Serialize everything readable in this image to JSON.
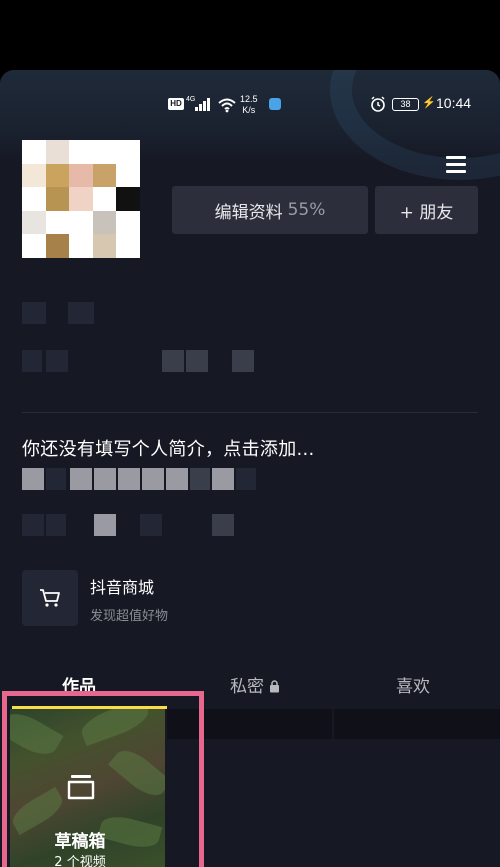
{
  "status_bar": {
    "hd_badge": "HD",
    "network": "4G",
    "speed_value": "12.5",
    "speed_unit": "K/s",
    "battery": "38",
    "time": "10:44"
  },
  "profile": {
    "edit_button_label": "编辑资料",
    "edit_progress": "55%",
    "add_friend_label": "+ 朋友",
    "bio_placeholder": "你还没有填写个人简介，点击添加..."
  },
  "shop": {
    "title": "抖音商城",
    "subtitle": "发现超值好物"
  },
  "tabs": [
    {
      "label": "作品",
      "active": true
    },
    {
      "label": "私密",
      "active": false,
      "icon": "lock-icon"
    },
    {
      "label": "喜欢",
      "active": false
    }
  ],
  "drafts": {
    "title": "草稿箱",
    "count": "2 个视频"
  },
  "colors": {
    "background": "#161823",
    "tab_underline": "#f9dc4a",
    "highlight_frame": "#e8678f"
  },
  "icons": [
    "hd-icon",
    "signal-icon",
    "wifi-icon",
    "alarm-icon",
    "battery-icon",
    "menu-icon",
    "cart-icon",
    "lock-icon",
    "draft-box-icon"
  ]
}
